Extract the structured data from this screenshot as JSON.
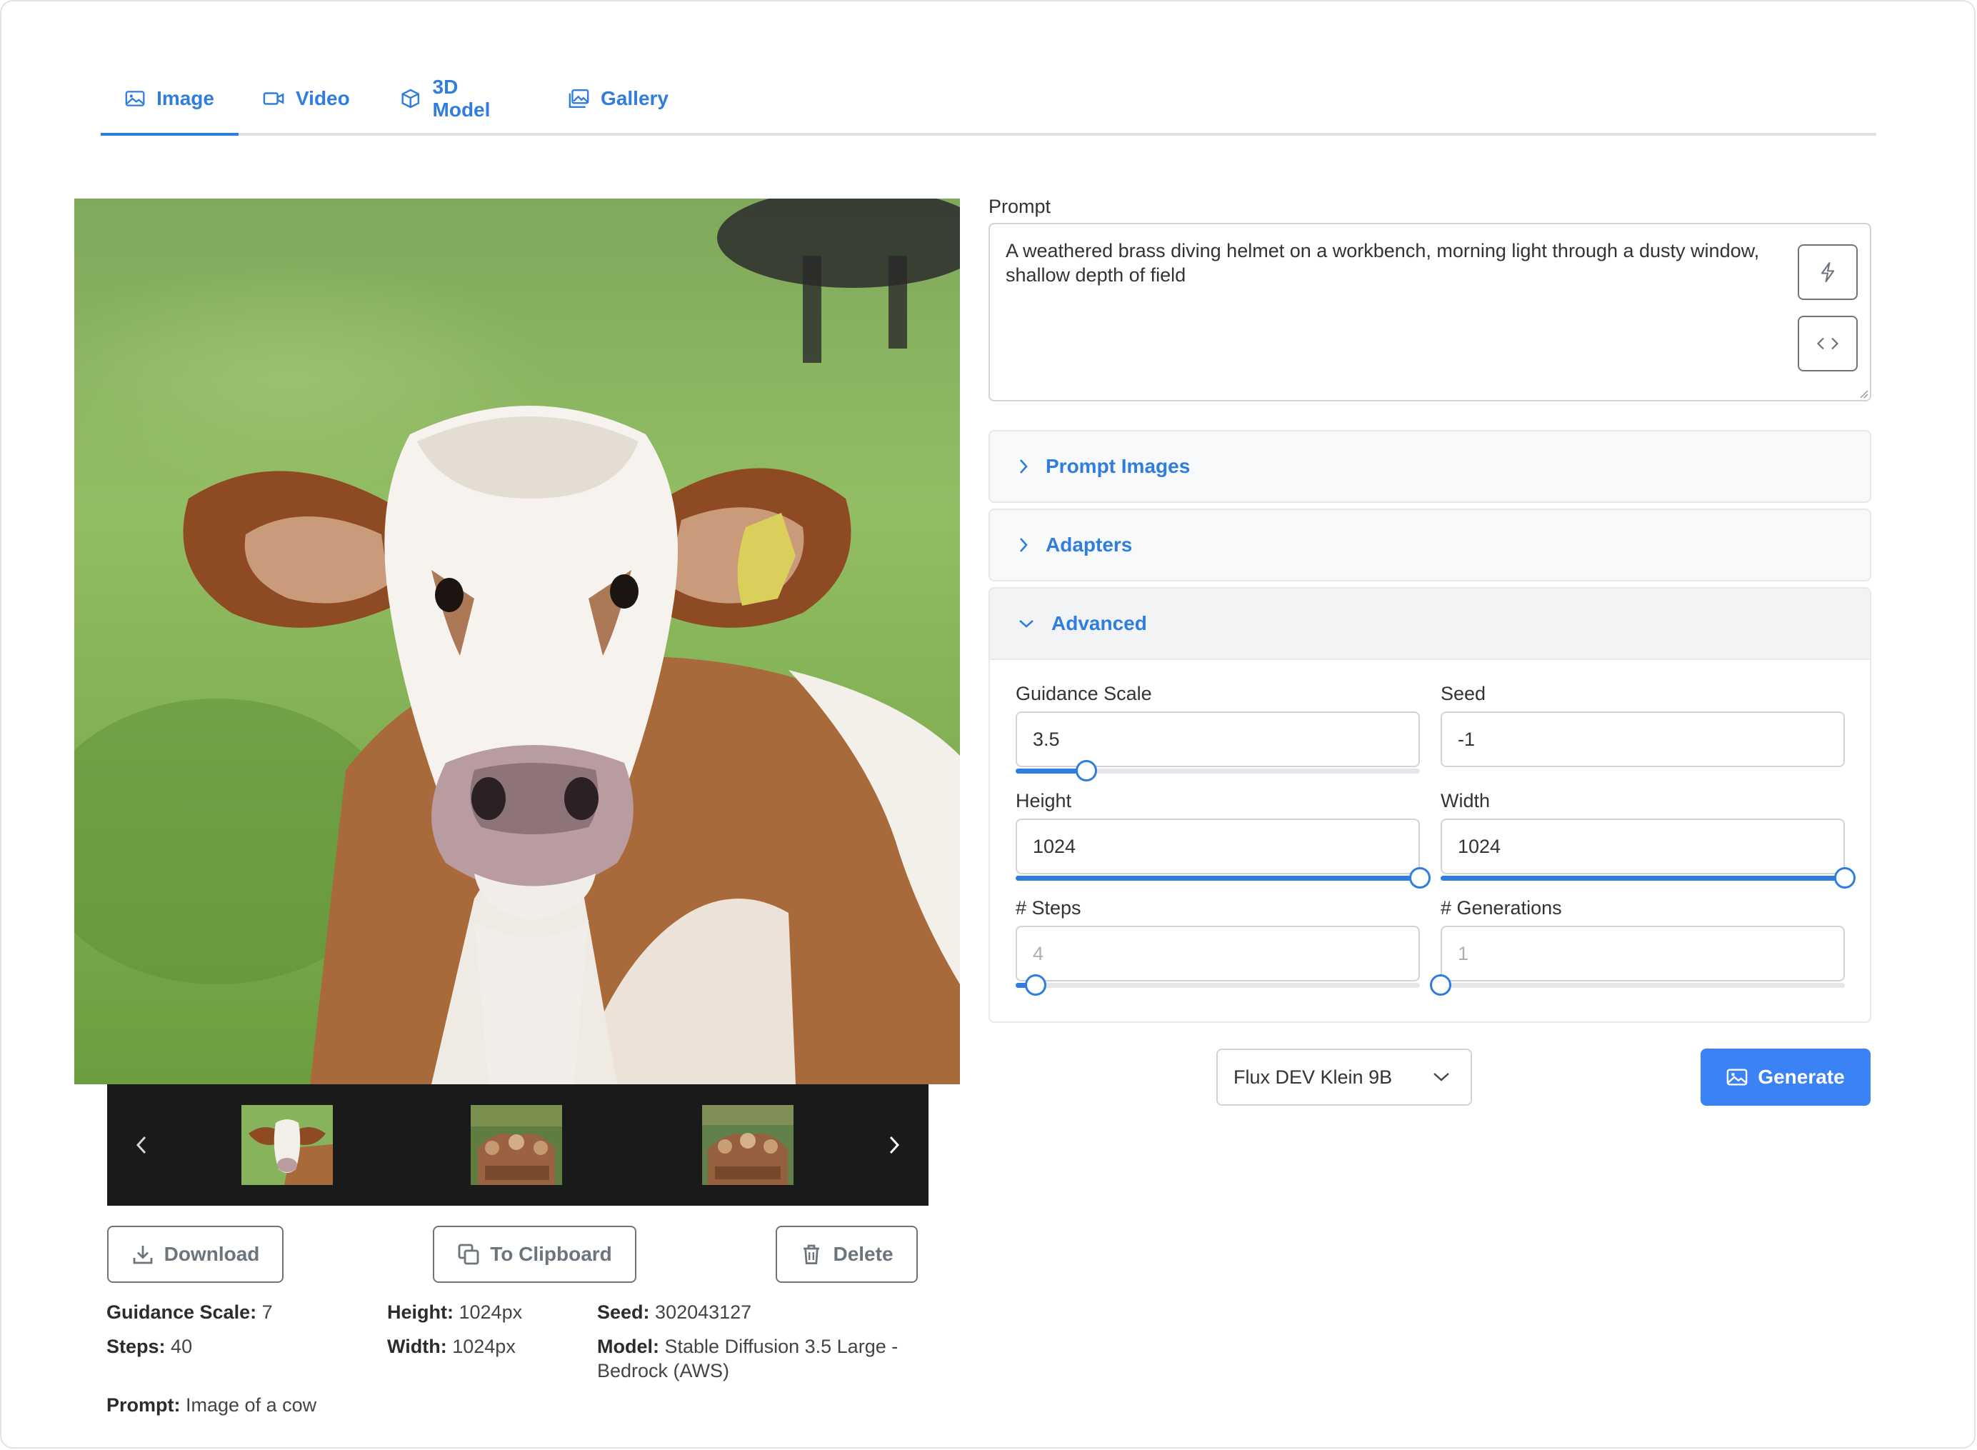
{
  "tabs": [
    {
      "label": "Image",
      "icon": "image-icon",
      "active": true
    },
    {
      "label": "Video",
      "icon": "video-icon"
    },
    {
      "label": "3D Model",
      "icon": "cube-icon"
    },
    {
      "label": "Gallery",
      "icon": "gallery-icon"
    }
  ],
  "actions": {
    "download": "Download",
    "clipboard": "To Clipboard",
    "delete": "Delete"
  },
  "metadata": {
    "guidance_scale": {
      "label": "Guidance Scale:",
      "value": "7"
    },
    "steps": {
      "label": "Steps:",
      "value": "40"
    },
    "height": {
      "label": "Height:",
      "value": "1024px"
    },
    "width": {
      "label": "Width:",
      "value": "1024px"
    },
    "seed": {
      "label": "Seed:",
      "value": "302043127"
    },
    "model": {
      "label": "Model:",
      "value": "Stable Diffusion 3.5 Large - Bedrock (AWS)"
    },
    "prompt": {
      "label": "Prompt:",
      "value": "Image of a cow"
    }
  },
  "prompt": {
    "label": "Prompt",
    "value": "A weathered brass diving helmet on a workbench, morning light through a dusty window, shallow depth of field"
  },
  "accordions": {
    "prompt_images": "Prompt Images",
    "adapters": "Adapters",
    "advanced": "Advanced"
  },
  "advanced": {
    "guidance_scale": {
      "label": "Guidance Scale",
      "value": "3.5",
      "fraction": 0.175
    },
    "seed": {
      "label": "Seed",
      "value": "-1"
    },
    "height": {
      "label": "Height",
      "value": "1024",
      "fraction": 1.0
    },
    "width": {
      "label": "Width",
      "value": "1024",
      "fraction": 1.0
    },
    "steps": {
      "label": "# Steps",
      "value": "4",
      "fraction": 0.05
    },
    "generations": {
      "label": "# Generations",
      "value": "1",
      "fraction": 0.0
    }
  },
  "model_select": {
    "value": "Flux DEV Klein 9B"
  },
  "generate_label": "Generate",
  "colors": {
    "accent": "#2f7ddf",
    "primary_button": "#3b82f6",
    "outline": "#6c757d"
  }
}
